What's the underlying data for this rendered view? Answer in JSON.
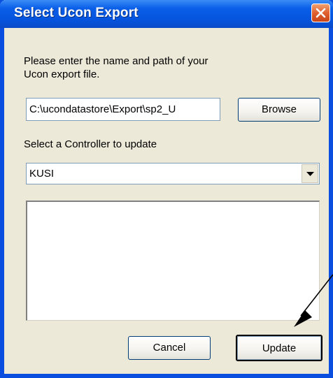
{
  "window": {
    "title": "Select Ucon Export",
    "close_icon": "close-icon"
  },
  "form": {
    "prompt_line1": "Please enter the name and path of your",
    "prompt_line2": "Ucon export file.",
    "path_value": "C:\\ucondatastore\\Export\\sp2_U",
    "browse_label": "Browse",
    "controller_label": "Select a Controller to update",
    "controller_selected": "KUSI",
    "dropdown_icon": "chevron-down-icon"
  },
  "buttons": {
    "cancel_label": "Cancel",
    "update_label": "Update"
  },
  "annotation": {
    "icon": "arrow-pointer-icon"
  },
  "colors": {
    "titlebar": "#0a5ee8",
    "window_border": "#0a4ee0",
    "dialog_bg": "#ece9d8",
    "close_button": "#e06030"
  }
}
